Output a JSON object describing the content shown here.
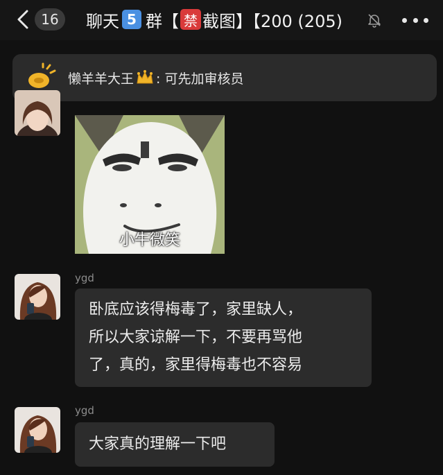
{
  "header": {
    "back_count": "16",
    "title_prefix": "聊天",
    "title_num": "5",
    "title_group": "群",
    "title_bracket_open": "【",
    "title_ban": "禁",
    "title_rest": "截图】【200 (205)",
    "mute_icon": "bell-off-icon",
    "more_icon": "more-dots-icon"
  },
  "announcement": {
    "icon": "megaphone-icon",
    "author": "懒羊羊大王",
    "crown_icon": "crown-icon",
    "text": ": 可先加审核员"
  },
  "messages": [
    {
      "type": "sticker",
      "caption": "小牛微笑"
    },
    {
      "type": "text",
      "sender": "ygd",
      "lines": [
        "卧底应该得梅毒了，家里缺人，",
        "所以大家谅解一下，不要再骂他",
        "了，真的，家里得梅毒也不容易"
      ]
    },
    {
      "type": "text",
      "sender": "ygd",
      "lines": [
        "大家真的理解一下吧"
      ]
    }
  ],
  "colors": {
    "background": "#111111",
    "bubble": "#2c2c2c",
    "announcement_bg": "#2b2b2b",
    "num_badge": "#4a90e2",
    "ban_badge": "#d93a3a"
  }
}
